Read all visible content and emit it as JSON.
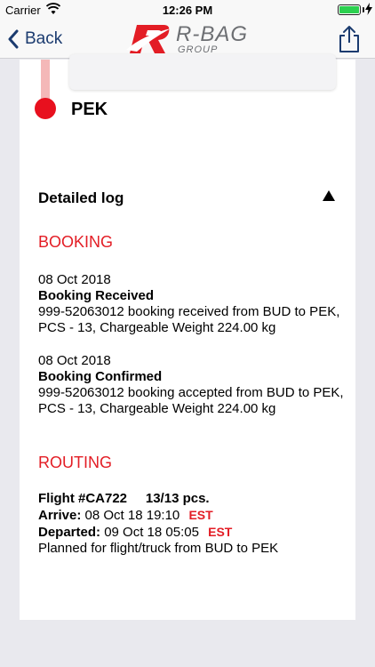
{
  "status_bar": {
    "carrier": "Carrier",
    "time": "12:26 PM"
  },
  "nav": {
    "back_label": "Back",
    "logo_name": "R-BAG",
    "logo_sub": "GROUP"
  },
  "timeline": {
    "destination": "PEK"
  },
  "log": {
    "header": "Detailed log",
    "booking": {
      "title": "BOOKING",
      "entries": [
        {
          "date": "08 Oct 2018",
          "event": "Booking Received",
          "detail": "999-52063012 booking received from BUD to PEK, PCS - 13, Chargeable Weight 224.00 kg"
        },
        {
          "date": "08 Oct 2018",
          "event": "Booking Confirmed",
          "detail": "999-52063012 booking accepted from BUD to PEK, PCS - 13, Chargeable Weight 224.00 kg"
        }
      ]
    },
    "routing": {
      "title": "ROUTING",
      "flight_label": "Flight #CA722",
      "pcs": "13/13 pcs.",
      "arrive_label": "Arrive:",
      "arrive_value": "08 Oct 18 19:10",
      "arrive_tz": "EST",
      "departed_label": "Departed:",
      "departed_value": "09 Oct 18 05:05",
      "departed_tz": "EST",
      "note": "Planned for flight/truck from BUD to PEK"
    }
  },
  "colors": {
    "accent_red": "#e31d25",
    "nav_blue": "#1b3b6f",
    "background": "#e9e9ee"
  }
}
